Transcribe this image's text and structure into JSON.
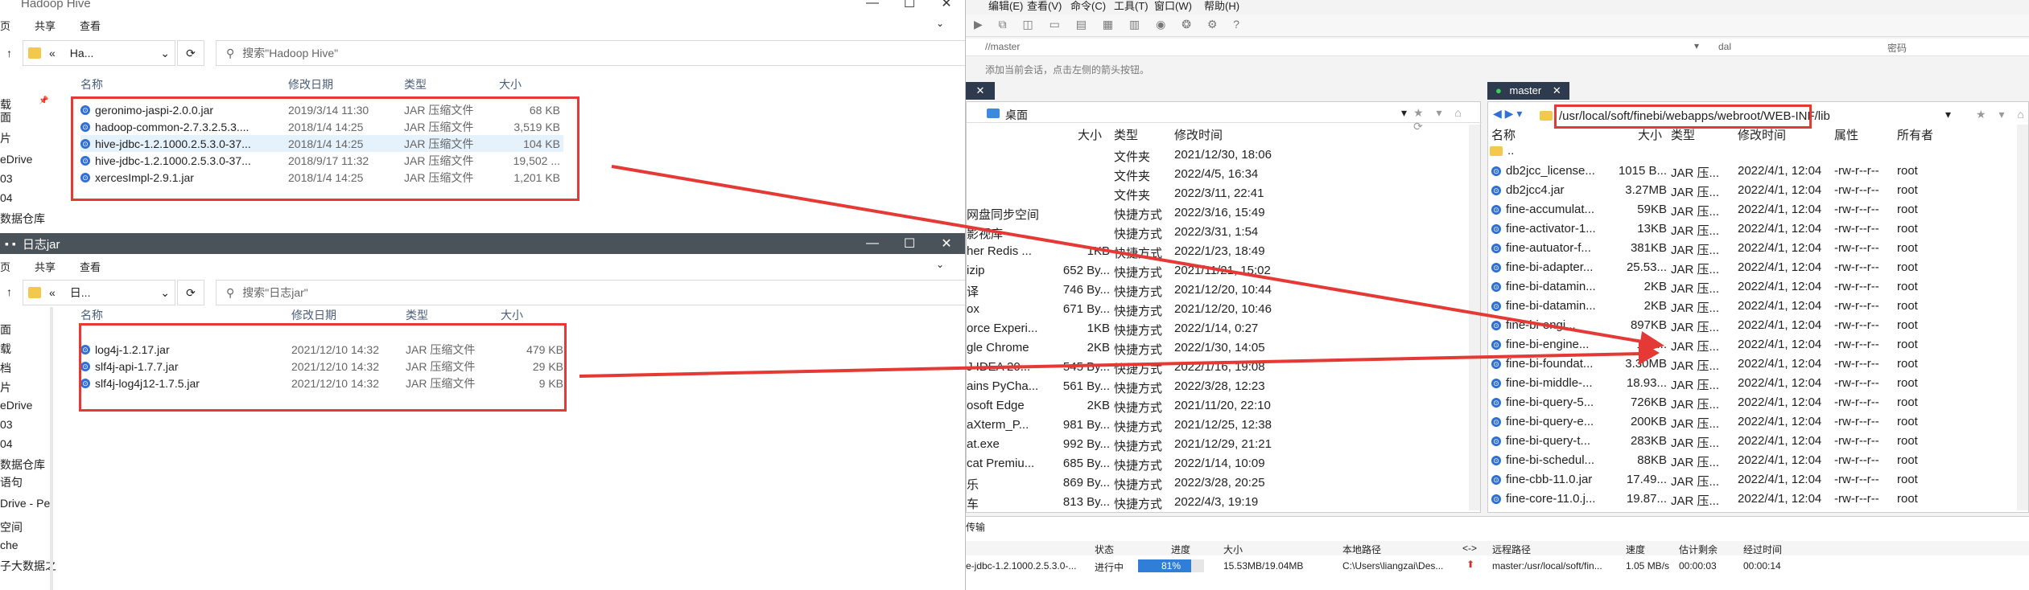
{
  "xshell": {
    "menu": [
      "编辑(E)",
      "查看(V)",
      "命令(C)",
      "工具(T)",
      "窗口(W)",
      "帮助(H)"
    ],
    "host_field": "//master",
    "hint": "添加当前会话，点击左侧的箭头按钮。",
    "dal": "dal",
    "pwd": "密码",
    "left_pane": {
      "path": "桌面",
      "headers": [
        "大小",
        "类型",
        "修改时间"
      ],
      "rows": [
        {
          "name": "",
          "size": "",
          "type": "文件夹",
          "time": "2021/12/30, 18:06"
        },
        {
          "name": "",
          "size": "",
          "type": "文件夹",
          "time": "2022/4/5, 16:34"
        },
        {
          "name": "",
          "size": "",
          "type": "文件夹",
          "time": "2022/3/11, 22:41"
        },
        {
          "name": "网盘同步空间",
          "size": "",
          "type": "快捷方式",
          "time": "2022/3/16, 15:49"
        },
        {
          "name": "影视库",
          "size": "",
          "type": "快捷方式",
          "time": "2022/3/31, 1:54"
        },
        {
          "name": "her Redis ...",
          "size": "1KB",
          "type": "快捷方式",
          "time": "2022/1/23, 18:49"
        },
        {
          "name": "izip",
          "size": "652 By...",
          "type": "快捷方式",
          "time": "2021/11/21, 15:02"
        },
        {
          "name": "译",
          "size": "746 By...",
          "type": "快捷方式",
          "time": "2021/12/20, 10:44"
        },
        {
          "name": "ox",
          "size": "671 By...",
          "type": "快捷方式",
          "time": "2021/12/20, 10:46"
        },
        {
          "name": "orce Experi...",
          "size": "1KB",
          "type": "快捷方式",
          "time": "2022/1/14, 0:27"
        },
        {
          "name": "gle Chrome",
          "size": "2KB",
          "type": "快捷方式",
          "time": "2022/1/30, 14:05"
        },
        {
          "name": "J IDEA 20...",
          "size": "545 By...",
          "type": "快捷方式",
          "time": "2022/1/16, 19:08"
        },
        {
          "name": "ains PyCha...",
          "size": "561 By...",
          "type": "快捷方式",
          "time": "2022/3/28, 12:23"
        },
        {
          "name": "osoft Edge",
          "size": "2KB",
          "type": "快捷方式",
          "time": "2021/11/20, 22:10"
        },
        {
          "name": "aXterm_P...",
          "size": "981 By...",
          "type": "快捷方式",
          "time": "2021/12/25, 12:38"
        },
        {
          "name": "at.exe",
          "size": "992 By...",
          "type": "快捷方式",
          "time": "2021/12/29, 21:21"
        },
        {
          "name": "cat Premiu...",
          "size": "685 By...",
          "type": "快捷方式",
          "time": "2022/1/14, 10:09"
        },
        {
          "name": "乐",
          "size": "869 By...",
          "type": "快捷方式",
          "time": "2022/3/28, 20:25"
        },
        {
          "name": "车",
          "size": "813 By...",
          "type": "快捷方式",
          "time": "2022/4/3, 19:19"
        }
      ]
    },
    "right_pane": {
      "tab": "master",
      "path": "/usr/local/soft/finebi/webapps/webroot/WEB-INF/lib",
      "headers": [
        "名称",
        "大小",
        "类型",
        "修改时间",
        "属性",
        "所有者"
      ],
      "up": "..",
      "rows": [
        {
          "name": "db2jcc_license...",
          "size": "1015 B...",
          "type": "JAR 压...",
          "time": "2022/4/1, 12:04",
          "attr": "-rw-r--r--",
          "owner": "root"
        },
        {
          "name": "db2jcc4.jar",
          "size": "3.27MB",
          "type": "JAR 压...",
          "time": "2022/4/1, 12:04",
          "attr": "-rw-r--r--",
          "owner": "root"
        },
        {
          "name": "fine-accumulat...",
          "size": "59KB",
          "type": "JAR 压...",
          "time": "2022/4/1, 12:04",
          "attr": "-rw-r--r--",
          "owner": "root"
        },
        {
          "name": "fine-activator-1...",
          "size": "13KB",
          "type": "JAR 压...",
          "time": "2022/4/1, 12:04",
          "attr": "-rw-r--r--",
          "owner": "root"
        },
        {
          "name": "fine-autuator-f...",
          "size": "381KB",
          "type": "JAR 压...",
          "time": "2022/4/1, 12:04",
          "attr": "-rw-r--r--",
          "owner": "root"
        },
        {
          "name": "fine-bi-adapter...",
          "size": "25.53...",
          "type": "JAR 压...",
          "time": "2022/4/1, 12:04",
          "attr": "-rw-r--r--",
          "owner": "root"
        },
        {
          "name": "fine-bi-datamin...",
          "size": "2KB",
          "type": "JAR 压...",
          "time": "2022/4/1, 12:04",
          "attr": "-rw-r--r--",
          "owner": "root"
        },
        {
          "name": "fine-bi-datamin...",
          "size": "2KB",
          "type": "JAR 压...",
          "time": "2022/4/1, 12:04",
          "attr": "-rw-r--r--",
          "owner": "root"
        },
        {
          "name": "fine-bi-engi...",
          "size": "897KB",
          "type": "JAR 压...",
          "time": "2022/4/1, 12:04",
          "attr": "-rw-r--r--",
          "owner": "root"
        },
        {
          "name": "fine-bi-engine...",
          "size": "157...",
          "type": "JAR 压...",
          "time": "2022/4/1, 12:04",
          "attr": "-rw-r--r--",
          "owner": "root"
        },
        {
          "name": "fine-bi-foundat...",
          "size": "3.30MB",
          "type": "JAR 压...",
          "time": "2022/4/1, 12:04",
          "attr": "-rw-r--r--",
          "owner": "root"
        },
        {
          "name": "fine-bi-middle-...",
          "size": "18.93...",
          "type": "JAR 压...",
          "time": "2022/4/1, 12:04",
          "attr": "-rw-r--r--",
          "owner": "root"
        },
        {
          "name": "fine-bi-query-5...",
          "size": "726KB",
          "type": "JAR 压...",
          "time": "2022/4/1, 12:04",
          "attr": "-rw-r--r--",
          "owner": "root"
        },
        {
          "name": "fine-bi-query-e...",
          "size": "200KB",
          "type": "JAR 压...",
          "time": "2022/4/1, 12:04",
          "attr": "-rw-r--r--",
          "owner": "root"
        },
        {
          "name": "fine-bi-query-t...",
          "size": "283KB",
          "type": "JAR 压...",
          "time": "2022/4/1, 12:04",
          "attr": "-rw-r--r--",
          "owner": "root"
        },
        {
          "name": "fine-bi-schedul...",
          "size": "88KB",
          "type": "JAR 压...",
          "time": "2022/4/1, 12:04",
          "attr": "-rw-r--r--",
          "owner": "root"
        },
        {
          "name": "fine-cbb-11.0.jar",
          "size": "17.49...",
          "type": "JAR 压...",
          "time": "2022/4/1, 12:04",
          "attr": "-rw-r--r--",
          "owner": "root"
        },
        {
          "name": "fine-core-11.0.j...",
          "size": "19.87...",
          "type": "JAR 压...",
          "time": "2022/4/1, 12:04",
          "attr": "-rw-r--r--",
          "owner": "root"
        }
      ]
    },
    "transfer": {
      "label": "传输",
      "headers": [
        "状态",
        "进度",
        "大小",
        "本地路径",
        "<->",
        "远程路径",
        "速度",
        "估计剩余",
        "经过时间"
      ],
      "row": {
        "name": "e-jdbc-1.2.1000.2.5.3.0-...",
        "status": "进行中",
        "progress": "81%",
        "progress_value": 0.81,
        "size": "15.53MB/19.04MB",
        "local": "C:\\Users\\liangzai\\Des...",
        "remote": "master:/usr/local/soft/fin...",
        "speed": "1.05 MB/s",
        "remain": "00:00:03",
        "elapsed": "00:00:14"
      }
    }
  },
  "explorer1": {
    "title": "Hadoop Hive",
    "ribbon": [
      "页",
      "共享",
      "查看"
    ],
    "crumbs": [
      "«",
      "Ha..."
    ],
    "search": "搜索\"Hadoop Hive\"",
    "headers": [
      "名称",
      "修改日期",
      "类型",
      "大小"
    ],
    "files": [
      {
        "name": "geronimo-jaspi-2.0.0.jar",
        "date": "2019/3/14 11:30",
        "type": "JAR 压缩文件",
        "size": "68 KB"
      },
      {
        "name": "hadoop-common-2.7.3.2.5.3....",
        "date": "2018/1/4 14:25",
        "type": "JAR 压缩文件",
        "size": "3,519 KB"
      },
      {
        "name": "hive-jdbc-1.2.1000.2.5.3.0-37...",
        "date": "2018/1/4 14:25",
        "type": "JAR 压缩文件",
        "size": "104 KB"
      },
      {
        "name": "hive-jdbc-1.2.1000.2.5.3.0-37...",
        "date": "2018/9/17 11:32",
        "type": "JAR 压缩文件",
        "size": "19,502 ..."
      },
      {
        "name": "xercesImpl-2.9.1.jar",
        "date": "2018/1/4 14:25",
        "type": "JAR 压缩文件",
        "size": "1,201 KB"
      }
    ],
    "sidebar": [
      "面",
      "载",
      "档",
      "片",
      "eDrive",
      "03",
      "04",
      "数据仓库",
      "语句",
      "空间",
      "che",
      "子大数据之"
    ]
  },
  "explorer2": {
    "title": "日志jar",
    "ribbon": [
      "页",
      "共享",
      "查看"
    ],
    "crumbs": [
      "«",
      "日..."
    ],
    "search": "搜索\"日志jar\"",
    "headers": [
      "名称",
      "修改日期",
      "类型",
      "大小"
    ],
    "files": [
      {
        "name": "log4j-1.2.17.jar",
        "date": "2021/12/10 14:32",
        "type": "JAR 压缩文件",
        "size": "479 KB"
      },
      {
        "name": "slf4j-api-1.7.7.jar",
        "date": "2021/12/10 14:32",
        "type": "JAR 压缩文件",
        "size": "29 KB"
      },
      {
        "name": "slf4j-log4j12-1.7.5.jar",
        "date": "2021/12/10 14:32",
        "type": "JAR 压缩文件",
        "size": "9 KB"
      }
    ],
    "sidebar": [
      "面",
      "载",
      "档",
      "片",
      "eDrive",
      "03",
      "04",
      "数据仓库",
      "语句",
      "Drive - Pe",
      "空间",
      "che",
      "子大数据之"
    ]
  }
}
